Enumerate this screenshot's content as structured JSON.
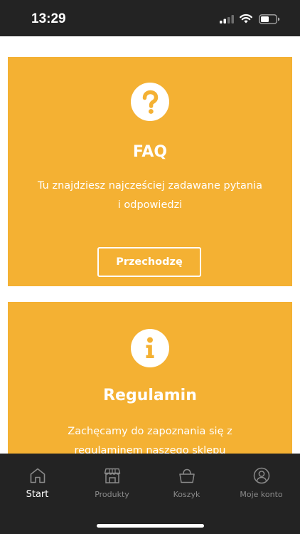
{
  "status_bar": {
    "time": "13:29",
    "icons": [
      "signal-icon",
      "wifi-icon",
      "battery-icon"
    ]
  },
  "colors": {
    "accent": "#f4b133",
    "dark": "#232323",
    "inactive": "#8a8a8a"
  },
  "cards": [
    {
      "icon": "question-icon",
      "title": "FAQ",
      "description": "Tu znajdziesz najcześciej zadawane pytania i odpowiedzi",
      "button_label": "Przechodzę"
    },
    {
      "icon": "info-icon",
      "title": "Regulamin",
      "description": "Zachęcamy do zapoznania się z regulaminem naszego sklepu"
    }
  ],
  "tabs": [
    {
      "label": "Start",
      "icon": "home-icon",
      "active": true
    },
    {
      "label": "Produkty",
      "icon": "store-icon",
      "active": false
    },
    {
      "label": "Koszyk",
      "icon": "basket-icon",
      "active": false
    },
    {
      "label": "Moje konto",
      "icon": "account-icon",
      "active": false
    }
  ]
}
